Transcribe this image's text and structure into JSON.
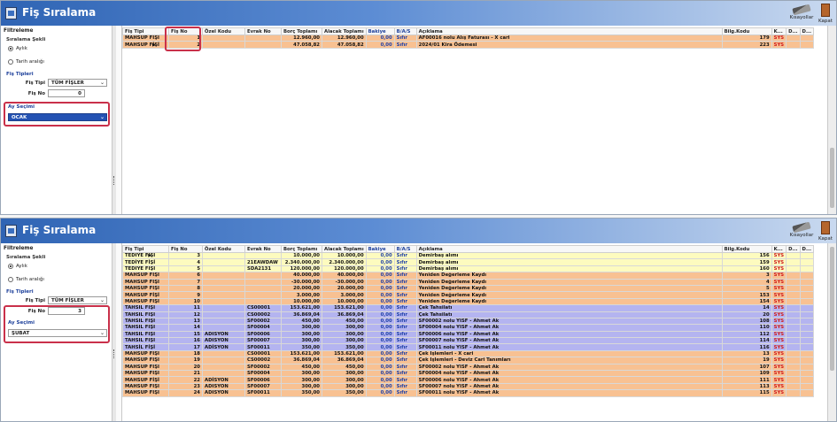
{
  "window_title": "Fiş Sıralama",
  "toolbar": {
    "tools_label": "Kısayollar",
    "close_label": "Kapat"
  },
  "filter": {
    "header": "Filtreleme",
    "sort_group": "Sıralama Şekli",
    "radio_monthly": "Aylık",
    "radio_date": "Tarih aralığı",
    "types_group": "Fiş Tipleri",
    "type_label": "Fiş Tipi",
    "no_label": "Fiş No",
    "month_group": "Ay Seçimi"
  },
  "top": {
    "type_value": "TÜM FİŞLER",
    "no_value": "0",
    "month_value": "OCAK"
  },
  "bottom": {
    "type_value": "TÜM FİŞLER",
    "no_value": "3",
    "month_value": "ŞUBAT"
  },
  "columns": [
    "Fiş Tipi",
    "Fiş No",
    "Özel Kodu",
    "Evrak No",
    "Borç Toplamı",
    "Alacak Toplamı",
    "Bakiye",
    "B/A/S",
    "Açıklama",
    "Bilg.Kodu",
    "K...",
    "D...",
    "D..."
  ],
  "top_rows": [
    {
      "type": "MAHSUP FİŞİ",
      "no": "1",
      "oz": "",
      "evrak": "",
      "borc": "12.960,00",
      "alacak": "12.960,00",
      "bakiye": "0,00",
      "bas": "Sıfır",
      "aciklama": "AF00016 nolu Alış Faturası - X cari",
      "bilg": "179",
      "k": "SYS",
      "marker": "",
      "color": "orange"
    },
    {
      "type": "MAHSUP FİŞİ",
      "no": "2",
      "oz": "",
      "evrak": "",
      "borc": "47.058,82",
      "alacak": "47.058,82",
      "bakiye": "0,00",
      "bas": "Sıfır",
      "aciklama": "2024/01 Kira Ödemesi",
      "bilg": "223",
      "k": "SYS",
      "marker": "▶",
      "color": "orange"
    }
  ],
  "bottom_rows": [
    {
      "type": "TEDİYE FİŞİ",
      "no": "3",
      "oz": "",
      "evrak": "",
      "borc": "10.000,00",
      "alacak": "10.000,00",
      "bakiye": "0,00",
      "bas": "Sıfır",
      "aciklama": "Demirbaş alımı",
      "bilg": "156",
      "k": "SYS",
      "marker": "▶",
      "color": "yellow"
    },
    {
      "type": "TEDİYE FİŞİ",
      "no": "4",
      "oz": "",
      "evrak": "21EAWDAW",
      "borc": "2.340.000,00",
      "alacak": "2.340.000,00",
      "bakiye": "0,00",
      "bas": "Sıfır",
      "aciklama": "Demirbaş alımı",
      "bilg": "159",
      "k": "SYS",
      "marker": "",
      "color": "yellow"
    },
    {
      "type": "TEDİYE FİŞİ",
      "no": "5",
      "oz": "",
      "evrak": "SDA2131",
      "borc": "120.000,00",
      "alacak": "120.000,00",
      "bakiye": "0,00",
      "bas": "Sıfır",
      "aciklama": "Demirbaş alımı",
      "bilg": "160",
      "k": "SYS",
      "marker": "",
      "color": "yellow"
    },
    {
      "type": "MAHSUP FİŞİ",
      "no": "6",
      "oz": "",
      "evrak": "",
      "borc": "40.000,00",
      "alacak": "40.000,00",
      "bakiye": "0,00",
      "bas": "Sıfır",
      "aciklama": "Yeniden Değerleme Kaydı",
      "bilg": "3",
      "k": "SYS",
      "marker": "",
      "color": "orange"
    },
    {
      "type": "MAHSUP FİŞİ",
      "no": "7",
      "oz": "",
      "evrak": "",
      "borc": "-30.000,00",
      "alacak": "-30.000,00",
      "bakiye": "0,00",
      "bas": "Sıfır",
      "aciklama": "Yeniden Değerleme Kaydı",
      "bilg": "4",
      "k": "SYS",
      "marker": "",
      "color": "orange"
    },
    {
      "type": "MAHSUP FİŞİ",
      "no": "8",
      "oz": "",
      "evrak": "",
      "borc": "20.000,00",
      "alacak": "20.000,00",
      "bakiye": "0,00",
      "bas": "Sıfır",
      "aciklama": "Yeniden Değerleme Kaydı",
      "bilg": "5",
      "k": "SYS",
      "marker": "",
      "color": "orange"
    },
    {
      "type": "MAHSUP FİŞİ",
      "no": "9",
      "oz": "",
      "evrak": "",
      "borc": "3.000,00",
      "alacak": "3.000,00",
      "bakiye": "0,00",
      "bas": "Sıfır",
      "aciklama": "Yeniden Değerleme Kaydı",
      "bilg": "153",
      "k": "SYS",
      "marker": "",
      "color": "orange"
    },
    {
      "type": "MAHSUP FİŞİ",
      "no": "10",
      "oz": "",
      "evrak": "",
      "borc": "10.000,00",
      "alacak": "10.000,00",
      "bakiye": "0,00",
      "bas": "Sıfır",
      "aciklama": "Yeniden Değerleme Kaydı",
      "bilg": "154",
      "k": "SYS",
      "marker": "",
      "color": "orange"
    },
    {
      "type": "TAHSİL FİŞİ",
      "no": "11",
      "oz": "",
      "evrak": "CS00001",
      "borc": "153.621,00",
      "alacak": "153.621,00",
      "bakiye": "0,00",
      "bas": "Sıfır",
      "aciklama": "Çek Tahsilatı",
      "bilg": "14",
      "k": "SYS",
      "marker": "",
      "color": "purple"
    },
    {
      "type": "TAHSİL FİŞİ",
      "no": "12",
      "oz": "",
      "evrak": "CS00002",
      "borc": "36.869,04",
      "alacak": "36.869,04",
      "bakiye": "0,00",
      "bas": "Sıfır",
      "aciklama": "Çek Tahsilatı",
      "bilg": "20",
      "k": "SYS",
      "marker": "",
      "color": "purple"
    },
    {
      "type": "TAHSİL FİŞİ",
      "no": "13",
      "oz": "",
      "evrak": "SF00002",
      "borc": "450,00",
      "alacak": "450,00",
      "bakiye": "0,00",
      "bas": "Sıfır",
      "aciklama": "SF00002 nolu YISF - Ahmet Ak",
      "bilg": "108",
      "k": "SYS",
      "marker": "",
      "color": "purple"
    },
    {
      "type": "TAHSİL FİŞİ",
      "no": "14",
      "oz": "",
      "evrak": "SF00004",
      "borc": "300,00",
      "alacak": "300,00",
      "bakiye": "0,00",
      "bas": "Sıfır",
      "aciklama": "SF00004 nolu YISF - Ahmet Ak",
      "bilg": "110",
      "k": "SYS",
      "marker": "",
      "color": "purple"
    },
    {
      "type": "TAHSİL FİŞİ",
      "no": "15",
      "oz": "ADİSYON",
      "evrak": "SF00006",
      "borc": "300,00",
      "alacak": "300,00",
      "bakiye": "0,00",
      "bas": "Sıfır",
      "aciklama": "SF00006 nolu YISF - Ahmet Ak",
      "bilg": "112",
      "k": "SYS",
      "marker": "",
      "color": "purple"
    },
    {
      "type": "TAHSİL FİŞİ",
      "no": "16",
      "oz": "ADİSYON",
      "evrak": "SF00007",
      "borc": "300,00",
      "alacak": "300,00",
      "bakiye": "0,00",
      "bas": "Sıfır",
      "aciklama": "SF00007 nolu YISF - Ahmet Ak",
      "bilg": "114",
      "k": "SYS",
      "marker": "",
      "color": "purple"
    },
    {
      "type": "TAHSİL FİŞİ",
      "no": "17",
      "oz": "ADİSYON",
      "evrak": "SF00011",
      "borc": "350,00",
      "alacak": "350,00",
      "bakiye": "0,00",
      "bas": "Sıfır",
      "aciklama": "SF00011 nolu YISF - Ahmet Ak",
      "bilg": "116",
      "k": "SYS",
      "marker": "",
      "color": "purple"
    },
    {
      "type": "MAHSUP FİŞİ",
      "no": "18",
      "oz": "",
      "evrak": "CS00001",
      "borc": "153.621,00",
      "alacak": "153.621,00",
      "bakiye": "0,00",
      "bas": "Sıfır",
      "aciklama": "Çek İşlemleri - X cari",
      "bilg": "13",
      "k": "SYS",
      "marker": "",
      "color": "orange"
    },
    {
      "type": "MAHSUP FİŞİ",
      "no": "19",
      "oz": "",
      "evrak": "CS00002",
      "borc": "36.869,04",
      "alacak": "36.869,04",
      "bakiye": "0,00",
      "bas": "Sıfır",
      "aciklama": "Çek İşlemleri - Deviz Cari Tanımları",
      "bilg": "19",
      "k": "SYS",
      "marker": "",
      "color": "orange"
    },
    {
      "type": "MAHSUP FİŞİ",
      "no": "20",
      "oz": "",
      "evrak": "SF00002",
      "borc": "450,00",
      "alacak": "450,00",
      "bakiye": "0,00",
      "bas": "Sıfır",
      "aciklama": "SF00002 nolu YISF - Ahmet Ak",
      "bilg": "107",
      "k": "SYS",
      "marker": "",
      "color": "orange"
    },
    {
      "type": "MAHSUP FİŞİ",
      "no": "21",
      "oz": "",
      "evrak": "SF00004",
      "borc": "300,00",
      "alacak": "300,00",
      "bakiye": "0,00",
      "bas": "Sıfır",
      "aciklama": "SF00004 nolu YISF - Ahmet Ak",
      "bilg": "109",
      "k": "SYS",
      "marker": "",
      "color": "orange"
    },
    {
      "type": "MAHSUP FİŞİ",
      "no": "22",
      "oz": "ADİSYON",
      "evrak": "SF00006",
      "borc": "300,00",
      "alacak": "300,00",
      "bakiye": "0,00",
      "bas": "Sıfır",
      "aciklama": "SF00006 nolu YISF - Ahmet Ak",
      "bilg": "111",
      "k": "SYS",
      "marker": "",
      "color": "orange"
    },
    {
      "type": "MAHSUP FİŞİ",
      "no": "23",
      "oz": "ADİSYON",
      "evrak": "SF00007",
      "borc": "300,00",
      "alacak": "300,00",
      "bakiye": "0,00",
      "bas": "Sıfır",
      "aciklama": "SF00007 nolu YISF - Ahmet Ak",
      "bilg": "113",
      "k": "SYS",
      "marker": "",
      "color": "orange"
    },
    {
      "type": "MAHSUP FİŞİ",
      "no": "24",
      "oz": "ADİSYON",
      "evrak": "SF00011",
      "borc": "350,00",
      "alacak": "350,00",
      "bakiye": "0,00",
      "bas": "Sıfır",
      "aciklama": "SF00011 nolu YISF - Ahmet Ak",
      "bilg": "115",
      "k": "SYS",
      "marker": "",
      "color": "orange"
    }
  ],
  "icons": {
    "app": "form-icon",
    "tools": "pen-icon",
    "close": "door-icon"
  }
}
